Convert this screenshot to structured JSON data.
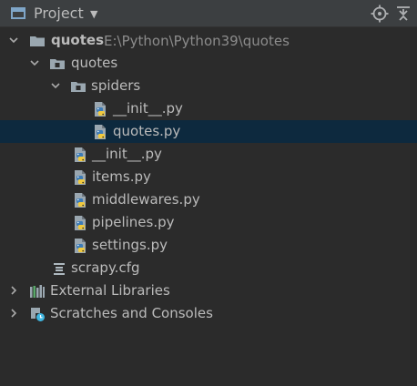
{
  "panel": {
    "title": "Project",
    "icons": [
      "window-icon",
      "dropdown-icon",
      "locate-icon",
      "collapse-icon"
    ]
  },
  "tree": {
    "root": {
      "label": "quotes",
      "path": "E:\\Python\\Python39\\quotes"
    },
    "pkg": {
      "label": "quotes"
    },
    "spiders": {
      "label": "spiders"
    },
    "spiders_init": {
      "label": "__init__.py"
    },
    "quotes_py": {
      "label": "quotes.py"
    },
    "pkg_init": {
      "label": "__init__.py"
    },
    "items": {
      "label": "items.py"
    },
    "middlewares": {
      "label": "middlewares.py"
    },
    "pipelines": {
      "label": "pipelines.py"
    },
    "settings": {
      "label": "settings.py"
    },
    "scrapy_cfg": {
      "label": "scrapy.cfg"
    },
    "external": {
      "label": "External Libraries"
    },
    "scratches": {
      "label": "Scratches and Consoles"
    }
  },
  "colors": {
    "background": "#2b2b2b",
    "header": "#3c3f41",
    "selection": "#0d293e",
    "text": "#bbbbbb",
    "path": "#8c8c8c"
  }
}
